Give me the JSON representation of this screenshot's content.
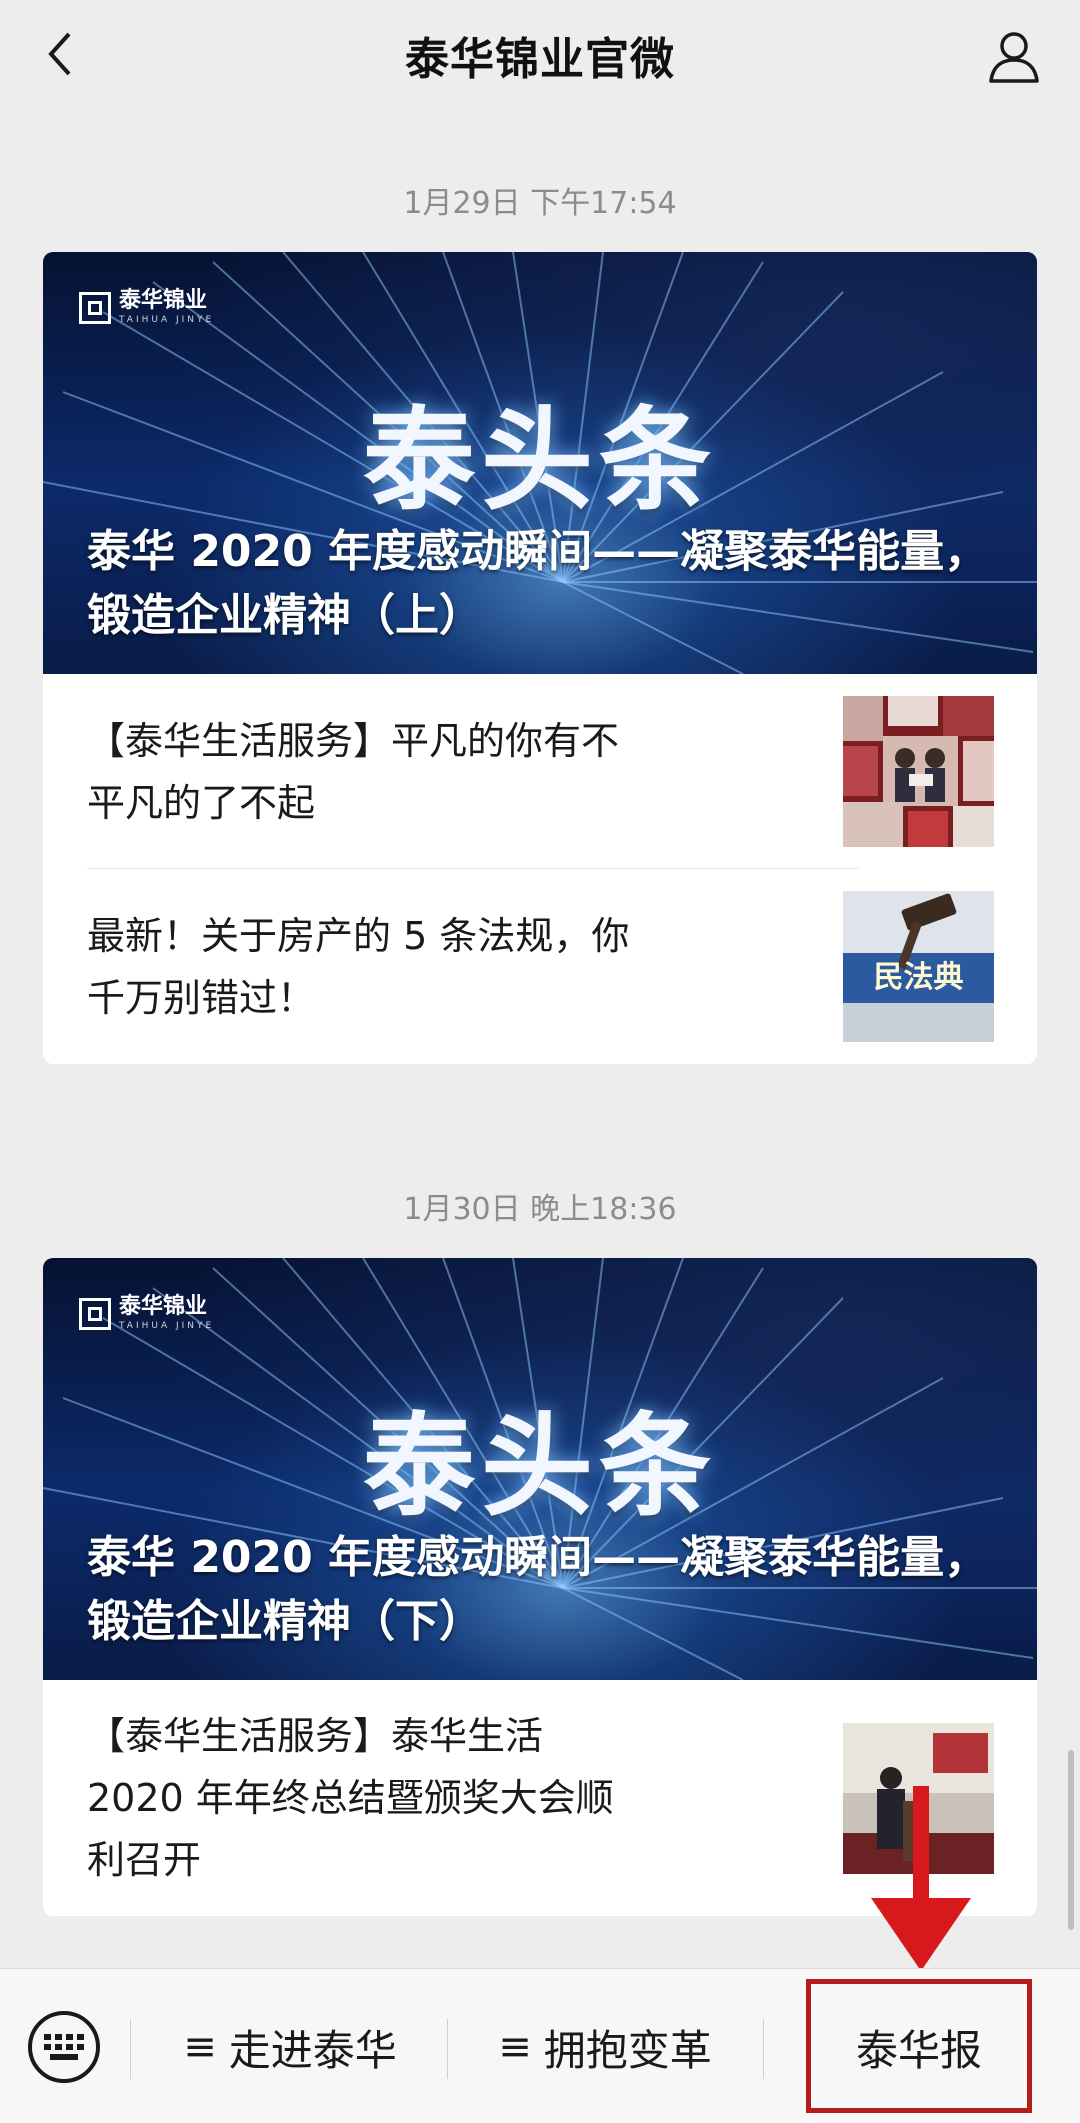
{
  "header": {
    "title": "泰华锦业官微"
  },
  "messages": [
    {
      "timestamp": "1月29日 下午17:54",
      "banner": {
        "logo_text": "泰华锦业",
        "logo_sub": "TAIHUA JINYE",
        "big_text": "泰头条",
        "headline": "泰华 2020 年度感动瞬间——凝聚泰华能量，锻造企业精神（上）"
      },
      "items": [
        {
          "title": "【泰华生活服务】平凡的你有不平凡的了不起"
        },
        {
          "title": "最新！关于房产的 5 条法规，你千万别错过！",
          "thumb_text": "民法典"
        }
      ]
    },
    {
      "timestamp": "1月30日 晚上18:36",
      "banner": {
        "logo_text": "泰华锦业",
        "logo_sub": "TAIHUA JINYE",
        "big_text": "泰头条",
        "headline": "泰华 2020 年度感动瞬间——凝聚泰华能量，锻造企业精神（下）"
      },
      "items": [
        {
          "title": "【泰华生活服务】泰华生活 2020 年年终总结暨颁奖大会顺利召开"
        }
      ]
    }
  ],
  "bottom_menu": {
    "items": [
      {
        "label": "走进泰华",
        "has_submenu": true
      },
      {
        "label": "拥抱变革",
        "has_submenu": true
      },
      {
        "label": "泰华报",
        "has_submenu": false
      }
    ],
    "submenu_glyph": "≡"
  },
  "colors": {
    "highlight": "#b51d1d",
    "background": "#ededed"
  }
}
